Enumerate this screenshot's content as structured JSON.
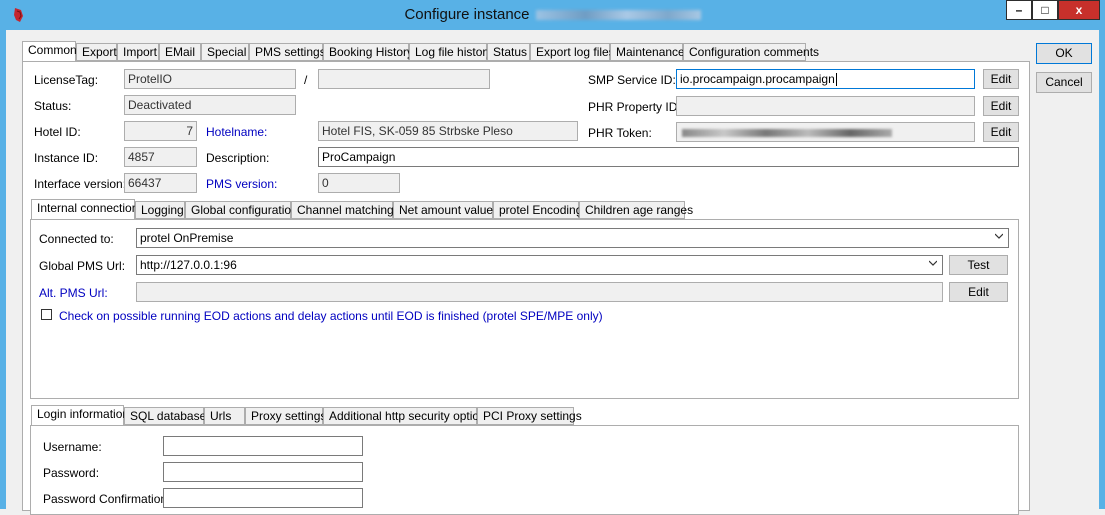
{
  "window": {
    "title": "Configure instance",
    "title_redacted": true,
    "minimize_glyph": "–",
    "maximize_glyph": "□",
    "close_glyph": "x"
  },
  "buttons": {
    "ok": "OK",
    "cancel": "Cancel"
  },
  "main_tabs": [
    "Common",
    "Export",
    "Import",
    "EMail",
    "Special",
    "PMS settings",
    "Booking History",
    "Log file history",
    "Status",
    "Export log files",
    "Maintenance",
    "Configuration comments"
  ],
  "common": {
    "license_tag_label": "LicenseTag:",
    "license_tag_value": "ProtelIO",
    "license_tag_sep": "/",
    "license_tag_value2": "",
    "status_label": "Status:",
    "status_value": "Deactivated",
    "hotel_id_label": "Hotel ID:",
    "hotel_id_value": "7",
    "hotelname_label": "Hotelname:",
    "hotelname_value": "Hotel FIS, SK-059 85 Strbske Pleso",
    "instance_id_label": "Instance ID:",
    "instance_id_value": "4857",
    "description_label": "Description:",
    "description_value": "ProCampaign",
    "interface_version_label": "Interface version:",
    "interface_version_value": "66437",
    "pms_version_label": "PMS version:",
    "pms_version_value": "0",
    "smp_service_id_label": "SMP Service ID:",
    "smp_service_id_value": "io.procampaign.procampaign",
    "phr_property_id_label": "PHR Property ID:",
    "phr_property_id_value": "",
    "phr_token_label": "PHR Token:",
    "phr_token_redacted": true,
    "edit_label": "Edit"
  },
  "connection_tabs": [
    "Internal connection",
    "Logging",
    "Global configuration",
    "Channel matchings",
    "Net amount values",
    "protel Encoding",
    "Children age ranges"
  ],
  "connection": {
    "connected_to_label": "Connected to:",
    "connected_to_value": "protel OnPremise",
    "global_pms_url_label": "Global PMS Url:",
    "global_pms_url_value": "http://127.0.0.1:96",
    "test_label": "Test",
    "alt_pms_url_label": "Alt. PMS Url:",
    "alt_pms_url_value": "",
    "edit_label": "Edit",
    "eod_check_label": "Check on possible running EOD actions and delay actions until EOD is finished (protel SPE/MPE only)",
    "eod_checked": false
  },
  "login_tabs": [
    "Login information",
    "SQL database",
    "Urls",
    "Proxy settings",
    "Additional http security options",
    "PCI Proxy settings"
  ],
  "login": {
    "username_label": "Username:",
    "username_value": "",
    "password_label": "Password:",
    "password_value": "",
    "password_confirm_label": "Password Confirmation:",
    "password_confirm_value": ""
  }
}
